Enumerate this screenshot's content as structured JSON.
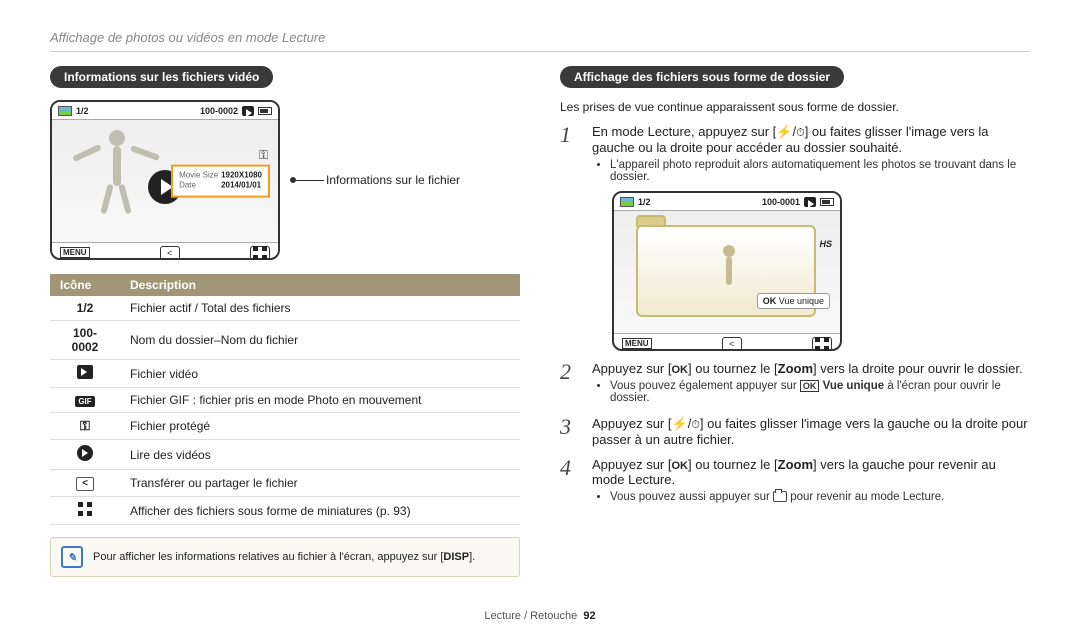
{
  "page_head": "Affichage de photos ou vidéos en mode Lecture",
  "left": {
    "heading": "Informations sur les fichiers vidéo",
    "screen_top_counter": "1/2",
    "screen_top_foldername": "100-0002",
    "info_movie_size_label": "Movie Size",
    "info_movie_size_value": "1920X1080",
    "info_date_label": "Date",
    "info_date_value": "2014/01/01",
    "menu_label": "MENU",
    "callout": "Informations sur le fichier",
    "th_icon": "Icône",
    "th_desc": "Description",
    "rows": [
      {
        "icon": "1/2",
        "desc": "Fichier actif / Total des fichiers"
      },
      {
        "icon": "100-0002",
        "desc": "Nom du dossier–Nom du fichier"
      },
      {
        "icon": "video",
        "desc": "Fichier vidéo"
      },
      {
        "icon": "GIF",
        "desc": "Fichier GIF : fichier pris en mode Photo en mouvement"
      },
      {
        "icon": "key",
        "desc": "Fichier protégé"
      },
      {
        "icon": "play",
        "desc": "Lire des vidéos"
      },
      {
        "icon": "share",
        "desc": "Transférer ou partager le fichier"
      },
      {
        "icon": "grid",
        "desc": "Afficher des fichiers sous forme de miniatures (p. 93)"
      }
    ],
    "note_text_a": "Pour afficher les informations relatives au fichier à l'écran, appuyez sur [",
    "note_disp": "DISP",
    "note_text_b": "]."
  },
  "right": {
    "heading": "Affichage des fichiers sous forme de dossier",
    "intro": "Les prises de vue continue apparaissent sous forme de dossier.",
    "step1_a": "En mode Lecture, appuyez sur [",
    "step1_b": "] ou faites glisser l'image vers la gauche ou la droite pour accéder au dossier souhaité.",
    "step1_sub": "L'appareil photo reproduit alors automatiquement les photos se trouvant dans le dossier.",
    "screen_counter": "1/2",
    "screen_folder": "100-0001",
    "ok_label": "OK",
    "view_unique": "Vue unique",
    "menu_label": "MENU",
    "hs_badge": "HS",
    "step2_a": "Appuyez sur [",
    "step2_b": "] ou tournez le [",
    "step2_zoom": "Zoom",
    "step2_c": "] vers la droite pour ouvrir le dossier.",
    "step2_sub_a": "Vous pouvez également appuyer sur ",
    "step2_sub_ok": "OK",
    "step2_sub_vu": "Vue unique",
    "step2_sub_b": " à l'écran pour ouvrir le dossier.",
    "step3_a": "Appuyez sur [",
    "step3_b": "] ou faites glisser l'image vers la gauche ou la droite pour passer à un autre fichier.",
    "step4_a": "Appuyez sur [",
    "step4_b": "] ou tournez le [",
    "step4_zoom": "Zoom",
    "step4_c": "] vers la gauche pour revenir au mode Lecture.",
    "step4_sub_a": "Vous pouvez aussi appuyer sur ",
    "step4_sub_b": " pour revenir au mode Lecture."
  },
  "footer": {
    "section": "Lecture / Retouche",
    "page": "92"
  }
}
